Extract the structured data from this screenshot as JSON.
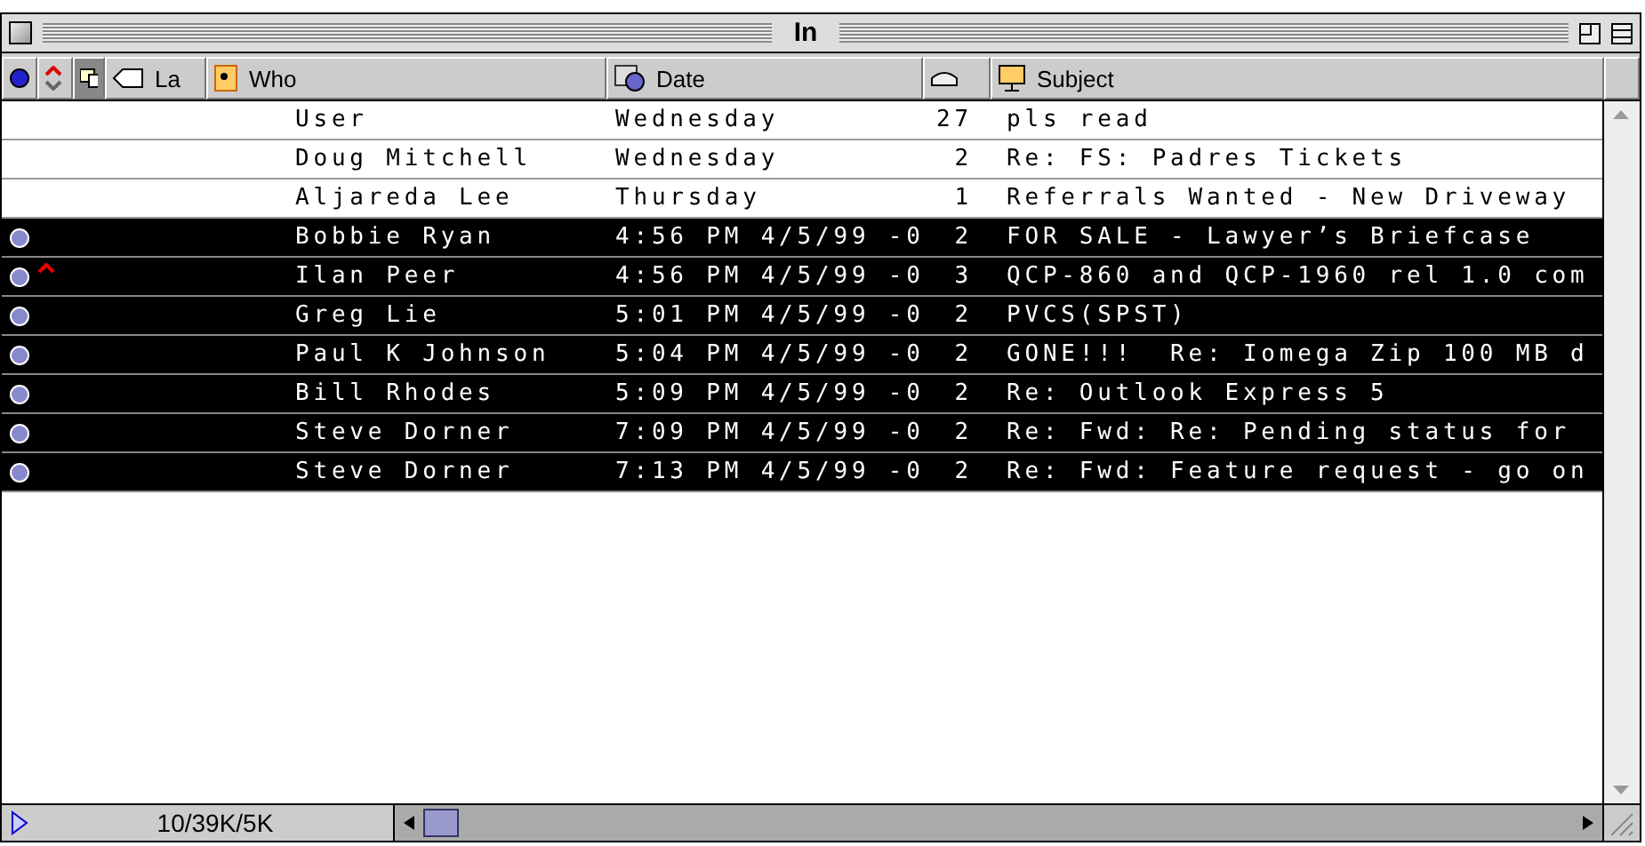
{
  "window": {
    "title": "In"
  },
  "columns": {
    "label": "La",
    "who": "Who",
    "date": "Date",
    "subject": "Subject"
  },
  "rows": [
    {
      "who": "User",
      "date": "Wednesday",
      "size": "27",
      "subject": "pls read",
      "selected": false,
      "unread": false,
      "priority_high": false
    },
    {
      "who": "Doug Mitchell",
      "date": "Wednesday",
      "size": "2",
      "subject": "Re: FS: Padres Tickets",
      "selected": false,
      "unread": false,
      "priority_high": false
    },
    {
      "who": "Aljareda Lee",
      "date": "Thursday",
      "size": "1",
      "subject": "Referrals Wanted - New Driveway",
      "selected": false,
      "unread": false,
      "priority_high": false
    },
    {
      "who": "Bobbie Ryan",
      "date": "4:56 PM 4/5/99 -0",
      "size": "2",
      "subject": "FOR SALE - Lawyer’s Briefcase",
      "selected": true,
      "unread": true,
      "priority_high": false
    },
    {
      "who": "Ilan Peer",
      "date": "4:56 PM 4/5/99 -0",
      "size": "3",
      "subject": "QCP-860 and QCP-1960 rel 1.0 com",
      "selected": true,
      "unread": true,
      "priority_high": true
    },
    {
      "who": "Greg Lie",
      "date": "5:01 PM 4/5/99 -0",
      "size": "2",
      "subject": "PVCS(SPST)",
      "selected": true,
      "unread": true,
      "priority_high": false
    },
    {
      "who": "Paul K Johnson",
      "date": "5:04 PM 4/5/99 -0",
      "size": "2",
      "subject": "GONE!!!  Re: Iomega Zip 100 MB d",
      "selected": true,
      "unread": true,
      "priority_high": false
    },
    {
      "who": "Bill Rhodes",
      "date": "5:09 PM 4/5/99 -0",
      "size": "2",
      "subject": "Re: Outlook Express 5",
      "selected": true,
      "unread": true,
      "priority_high": false
    },
    {
      "who": "Steve Dorner",
      "date": "7:09 PM 4/5/99 -0",
      "size": "2",
      "subject": "Re: Fwd: Re: Pending status for",
      "selected": true,
      "unread": true,
      "priority_high": false
    },
    {
      "who": "Steve Dorner",
      "date": "7:13 PM 4/5/99 -0",
      "size": "2",
      "subject": "Re: Fwd: Feature request - go on",
      "selected": true,
      "unread": true,
      "priority_high": false
    }
  ],
  "status_bar": {
    "summary": "10/39K/5K"
  }
}
